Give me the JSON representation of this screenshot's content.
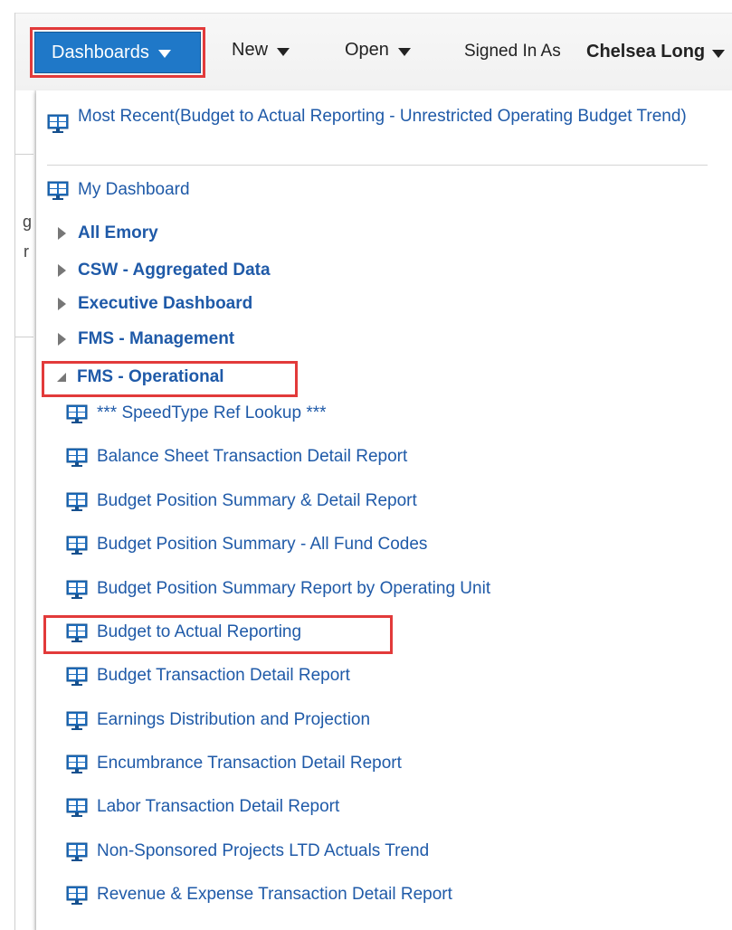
{
  "header": {
    "dashboards_label": "Dashboards",
    "new_label": "New",
    "open_label": "Open",
    "signed_in_label": "Signed In As",
    "user_name": "Chelsea Long"
  },
  "background_fragments": [
    "g",
    "r"
  ],
  "dropdown": {
    "most_recent": "Most Recent(Budget to Actual Reporting - Unrestricted Operating Budget Trend)",
    "my_dashboard": "My Dashboard",
    "folders": [
      {
        "label": "All Emory",
        "expanded": false
      },
      {
        "label": "CSW - Aggregated Data",
        "expanded": false
      },
      {
        "label": "Executive Dashboard",
        "expanded": false
      },
      {
        "label": "FMS - Management",
        "expanded": false
      },
      {
        "label": "FMS - Operational",
        "expanded": true
      }
    ],
    "items": [
      "*** SpeedType Ref Lookup ***",
      "Balance Sheet Transaction Detail Report",
      "Budget Position Summary & Detail Report",
      "Budget Position Summary - All Fund Codes",
      "Budget Position Summary Report by Operating Unit",
      "Budget to Actual Reporting",
      "Budget Transaction Detail Report",
      "Earnings Distribution and Projection",
      "Encumbrance Transaction Detail Report",
      "Labor Transaction Detail Report",
      "Non-Sponsored Projects LTD Actuals Trend",
      "Revenue & Expense Transaction Detail Report"
    ]
  },
  "colors": {
    "accent": "#1f78c8",
    "link": "#1f5aa8",
    "highlight": "#e23a3a"
  },
  "icons": {
    "dashboard_item": "dashboard-icon",
    "collapsed_folder": "expand-triangle-icon",
    "expanded_folder": "collapse-triangle-icon"
  }
}
